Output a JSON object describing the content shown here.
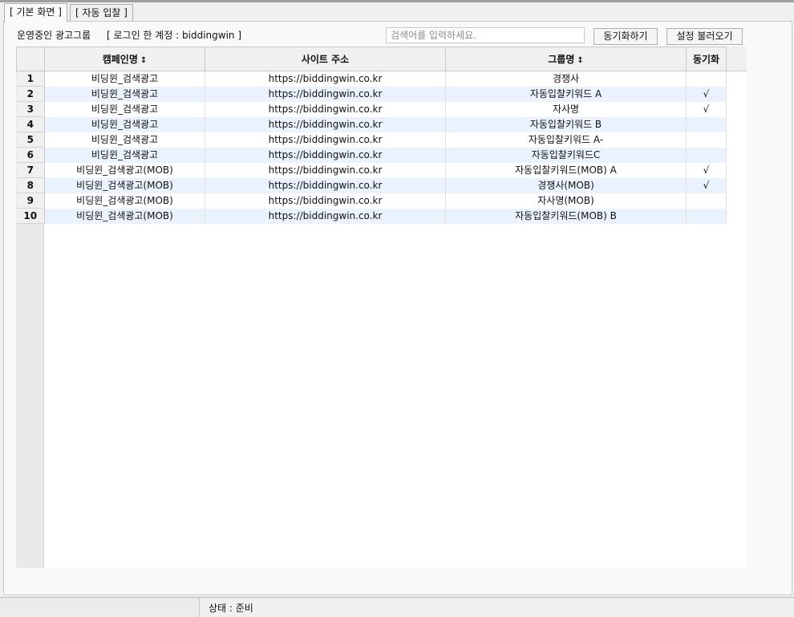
{
  "tabs": [
    {
      "label": "[ 기본 화면 ]",
      "active": true
    },
    {
      "label": "[ 자동 입찰 ]",
      "active": false
    }
  ],
  "main": {
    "caption": "운영중인 광고그룹",
    "account_text": "[ 로그인 한 계정 : biddingwin ]",
    "search": {
      "placeholder": "검색어를 입력하세요.",
      "value": ""
    },
    "sync_button": "동기화하기",
    "load_button": "설정 불러오기"
  },
  "table": {
    "columns": [
      {
        "label": "캠페인명",
        "sortable": true
      },
      {
        "label": "사이트 주소",
        "sortable": false
      },
      {
        "label": "그룹명",
        "sortable": true
      },
      {
        "label": "동기화",
        "sortable": false
      }
    ],
    "sort_icon": "↕",
    "rows": [
      {
        "num": "1",
        "campaign": "비딩윈_검색광고",
        "site": "https://biddingwin.co.kr",
        "group": "경쟁사",
        "sync": ""
      },
      {
        "num": "2",
        "campaign": "비딩윈_검색광고",
        "site": "https://biddingwin.co.kr",
        "group": "자동입찰키워드 A",
        "sync": "√"
      },
      {
        "num": "3",
        "campaign": "비딩윈_검색광고",
        "site": "https://biddingwin.co.kr",
        "group": "자사명",
        "sync": "√"
      },
      {
        "num": "4",
        "campaign": "비딩윈_검색광고",
        "site": "https://biddingwin.co.kr",
        "group": "자동입찰키워드 B",
        "sync": ""
      },
      {
        "num": "5",
        "campaign": "비딩윈_검색광고",
        "site": "https://biddingwin.co.kr",
        "group": "자동입찰키워드 A-",
        "sync": ""
      },
      {
        "num": "6",
        "campaign": "비딩윈_검색광고",
        "site": "https://biddingwin.co.kr",
        "group": "자동입찰키워드C",
        "sync": ""
      },
      {
        "num": "7",
        "campaign": "비딩윈_검색광고(MOB)",
        "site": "https://biddingwin.co.kr",
        "group": "자동입찰키워드(MOB) A",
        "sync": "√"
      },
      {
        "num": "8",
        "campaign": "비딩윈_검색광고(MOB)",
        "site": "https://biddingwin.co.kr",
        "group": "경쟁사(MOB)",
        "sync": "√"
      },
      {
        "num": "9",
        "campaign": "비딩윈_검색광고(MOB)",
        "site": "https://biddingwin.co.kr",
        "group": "자사명(MOB)",
        "sync": ""
      },
      {
        "num": "10",
        "campaign": "비딩윈_검색광고(MOB)",
        "site": "https://biddingwin.co.kr",
        "group": "자동입찰키워드(MOB) B",
        "sync": ""
      }
    ]
  },
  "statusbar": {
    "left": "",
    "status": "상태 : 준비"
  },
  "colors": {
    "row_alt": "#eaf3fd",
    "header_bg": "#f0f0f0",
    "grid_border": "#c8c8c8"
  }
}
